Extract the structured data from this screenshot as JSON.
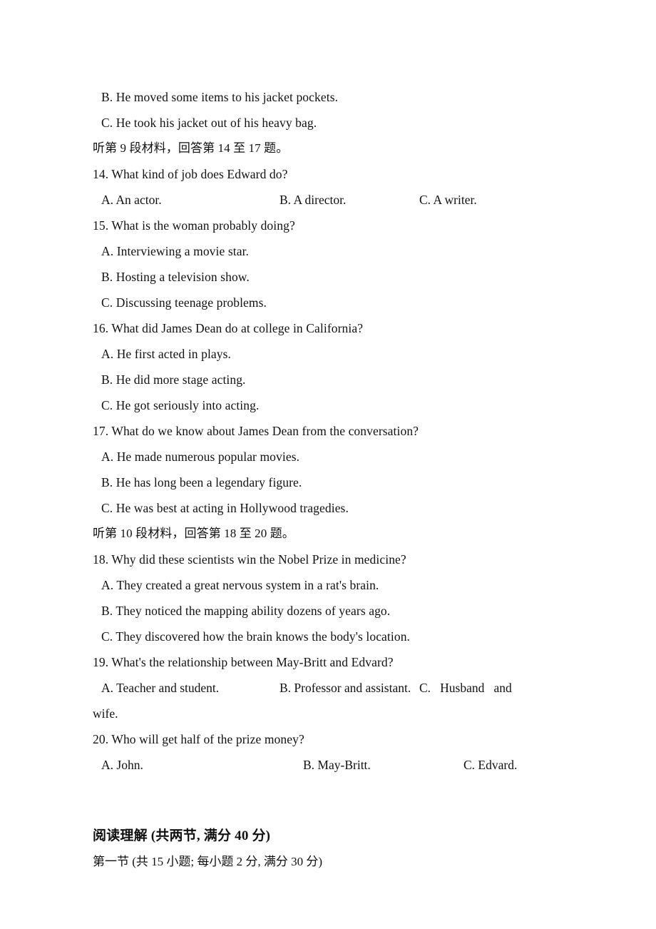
{
  "document": {
    "type": "exam-paper",
    "language": "mixed-chinese-english",
    "subject": "English listening comprehension",
    "page_background": "#ffffff",
    "text_color": "#111111"
  },
  "carryover_options": {
    "option_b": "B. He moved some items to his jacket pockets.",
    "option_c": "C. He took his jacket out of his heavy bag."
  },
  "directives": {
    "passage_9": "听第 9 段材料，回答第 14 至 17 题。",
    "passage_10": "听第 10 段材料，回答第 18 至 20 题。"
  },
  "questions": [
    {
      "number": "14",
      "stem": "14. What kind of job does Edward do?",
      "layout": "three-column",
      "options": {
        "a": "A. An actor.",
        "b": "B. A director.",
        "c": "C. A writer."
      }
    },
    {
      "number": "15",
      "stem": "15. What is the woman probably doing?",
      "layout": "stacked",
      "options": {
        "a": "A. Interviewing a movie star.",
        "b": "B. Hosting a television show.",
        "c": "C. Discussing teenage problems."
      }
    },
    {
      "number": "16",
      "stem": "16. What did James Dean do at college in California?",
      "layout": "stacked",
      "options": {
        "a": "A. He first acted in plays.",
        "b": "B. He did more stage acting.",
        "c": "C. He got seriously into acting."
      }
    },
    {
      "number": "17",
      "stem": "17. What do we know about James Dean from the conversation?",
      "layout": "stacked",
      "options": {
        "a": "A. He made numerous popular movies.",
        "b": "B. He has long been a legendary figure.",
        "c": "C. He was best at acting in Hollywood tragedies."
      }
    },
    {
      "number": "18",
      "stem": "18. Why did these scientists win the Nobel Prize in medicine?",
      "layout": "stacked",
      "options": {
        "a": "A. They created a great nervous system in a rat's brain.",
        "b": "B. They noticed the mapping ability dozens of years ago.",
        "c": "C. They discovered how the brain knows the body's location."
      }
    },
    {
      "number": "19",
      "stem": "19. What's the relationship between May-Britt and Edvard?",
      "layout": "justified-wrap",
      "options": {
        "a": "A. Teacher and student.",
        "b": "B. Professor and assistant.",
        "c_first_line": "C.   Husband   and",
        "c_wrapped": "wife."
      }
    },
    {
      "number": "20",
      "stem": "20. Who will get half of the prize money?",
      "layout": "three-column",
      "options": {
        "a": "A. John.",
        "b": "B. May-Britt.",
        "c": "C. Edvard."
      }
    }
  ],
  "reading_section": {
    "heading": "阅读理解 (共两节, 满分 40 分)",
    "subheading": "第一节 (共 15 小题; 每小题 2 分, 满分 30 分)"
  }
}
